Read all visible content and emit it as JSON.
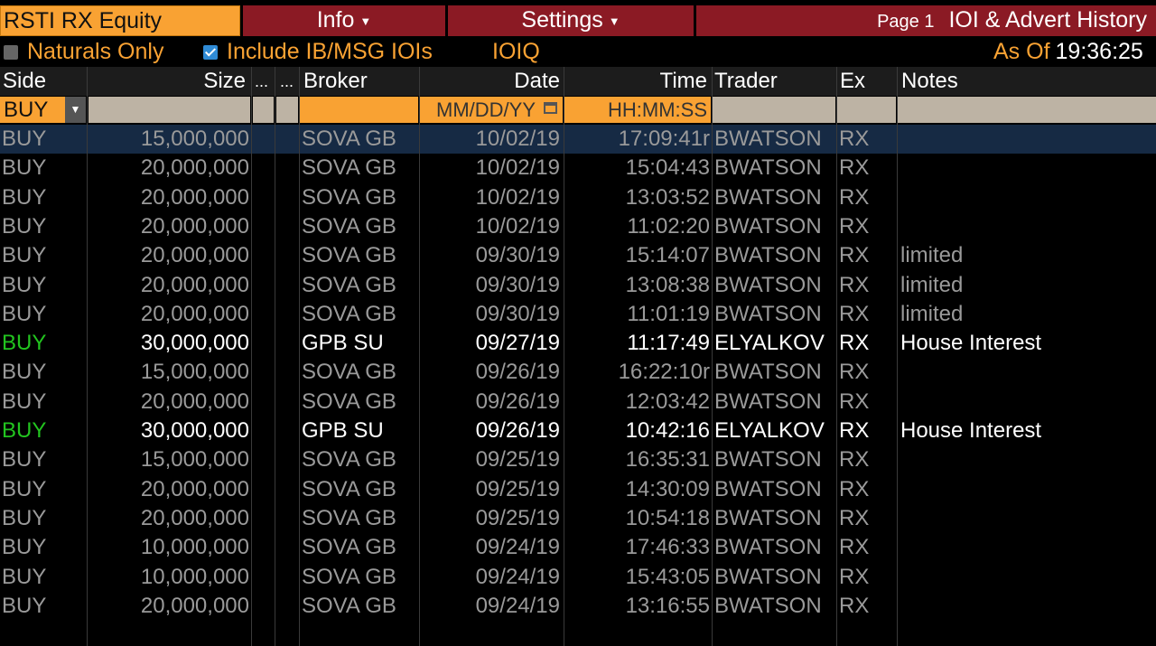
{
  "toolbar": {
    "ticker": "RSTI RX Equity",
    "info_label": "Info",
    "settings_label": "Settings",
    "page_label": "Page 1",
    "title": "IOI & Advert History"
  },
  "options": {
    "naturals_only": "Naturals Only",
    "include_ib_msg": "Include IB/MSG IOIs",
    "ioiq": "IOIQ",
    "as_of_label": "As Of",
    "as_of_time": "19:36:25"
  },
  "columns": {
    "side": "Side",
    "size": "Size",
    "c3": "...",
    "c4": "...",
    "broker": "Broker",
    "date": "Date",
    "time": "Time",
    "trader": "Trader",
    "ex": "Ex",
    "notes": "Notes"
  },
  "filters": {
    "side": "BUY",
    "date_placeholder": "MM/DD/YY",
    "time_placeholder": "HH:MM:SS"
  },
  "colors": {
    "accent_orange": "#f9a233",
    "menu_red": "#8b1a24",
    "buy_green": "#22c41f",
    "selected_row": "#162a44"
  },
  "rows": [
    {
      "side": "BUY",
      "size": "15,000,000",
      "broker": "SOVA GB",
      "date": "10/02/19",
      "time": "17:09:41r",
      "trader": "BWATSON",
      "ex": "RX",
      "notes": "",
      "highlight": false,
      "selected": true
    },
    {
      "side": "BUY",
      "size": "20,000,000",
      "broker": "SOVA GB",
      "date": "10/02/19",
      "time": "15:04:43",
      "trader": "BWATSON",
      "ex": "RX",
      "notes": "",
      "highlight": false
    },
    {
      "side": "BUY",
      "size": "20,000,000",
      "broker": "SOVA GB",
      "date": "10/02/19",
      "time": "13:03:52",
      "trader": "BWATSON",
      "ex": "RX",
      "notes": "",
      "highlight": false
    },
    {
      "side": "BUY",
      "size": "20,000,000",
      "broker": "SOVA GB",
      "date": "10/02/19",
      "time": "11:02:20",
      "trader": "BWATSON",
      "ex": "RX",
      "notes": "",
      "highlight": false
    },
    {
      "side": "BUY",
      "size": "20,000,000",
      "broker": "SOVA GB",
      "date": "09/30/19",
      "time": "15:14:07",
      "trader": "BWATSON",
      "ex": "RX",
      "notes": "limited",
      "highlight": false
    },
    {
      "side": "BUY",
      "size": "20,000,000",
      "broker": "SOVA GB",
      "date": "09/30/19",
      "time": "13:08:38",
      "trader": "BWATSON",
      "ex": "RX",
      "notes": "limited",
      "highlight": false
    },
    {
      "side": "BUY",
      "size": "20,000,000",
      "broker": "SOVA GB",
      "date": "09/30/19",
      "time": "11:01:19",
      "trader": "BWATSON",
      "ex": "RX",
      "notes": "limited",
      "highlight": false
    },
    {
      "side": "BUY",
      "size": "30,000,000",
      "broker": "GPB SU",
      "date": "09/27/19",
      "time": "11:17:49",
      "trader": "ELYALKOV",
      "ex": "RX",
      "notes": "House Interest",
      "highlight": true
    },
    {
      "side": "BUY",
      "size": "15,000,000",
      "broker": "SOVA GB",
      "date": "09/26/19",
      "time": "16:22:10r",
      "trader": "BWATSON",
      "ex": "RX",
      "notes": "",
      "highlight": false
    },
    {
      "side": "BUY",
      "size": "20,000,000",
      "broker": "SOVA GB",
      "date": "09/26/19",
      "time": "12:03:42",
      "trader": "BWATSON",
      "ex": "RX",
      "notes": "",
      "highlight": false
    },
    {
      "side": "BUY",
      "size": "30,000,000",
      "broker": "GPB SU",
      "date": "09/26/19",
      "time": "10:42:16",
      "trader": "ELYALKOV",
      "ex": "RX",
      "notes": "House Interest",
      "highlight": true
    },
    {
      "side": "BUY",
      "size": "15,000,000",
      "broker": "SOVA GB",
      "date": "09/25/19",
      "time": "16:35:31",
      "trader": "BWATSON",
      "ex": "RX",
      "notes": "",
      "highlight": false
    },
    {
      "side": "BUY",
      "size": "20,000,000",
      "broker": "SOVA GB",
      "date": "09/25/19",
      "time": "14:30:09",
      "trader": "BWATSON",
      "ex": "RX",
      "notes": "",
      "highlight": false
    },
    {
      "side": "BUY",
      "size": "20,000,000",
      "broker": "SOVA GB",
      "date": "09/25/19",
      "time": "10:54:18",
      "trader": "BWATSON",
      "ex": "RX",
      "notes": "",
      "highlight": false
    },
    {
      "side": "BUY",
      "size": "10,000,000",
      "broker": "SOVA GB",
      "date": "09/24/19",
      "time": "17:46:33",
      "trader": "BWATSON",
      "ex": "RX",
      "notes": "",
      "highlight": false
    },
    {
      "side": "BUY",
      "size": "10,000,000",
      "broker": "SOVA GB",
      "date": "09/24/19",
      "time": "15:43:05",
      "trader": "BWATSON",
      "ex": "RX",
      "notes": "",
      "highlight": false
    },
    {
      "side": "BUY",
      "size": "20,000,000",
      "broker": "SOVA GB",
      "date": "09/24/19",
      "time": "13:16:55",
      "trader": "BWATSON",
      "ex": "RX",
      "notes": "",
      "highlight": false
    }
  ]
}
